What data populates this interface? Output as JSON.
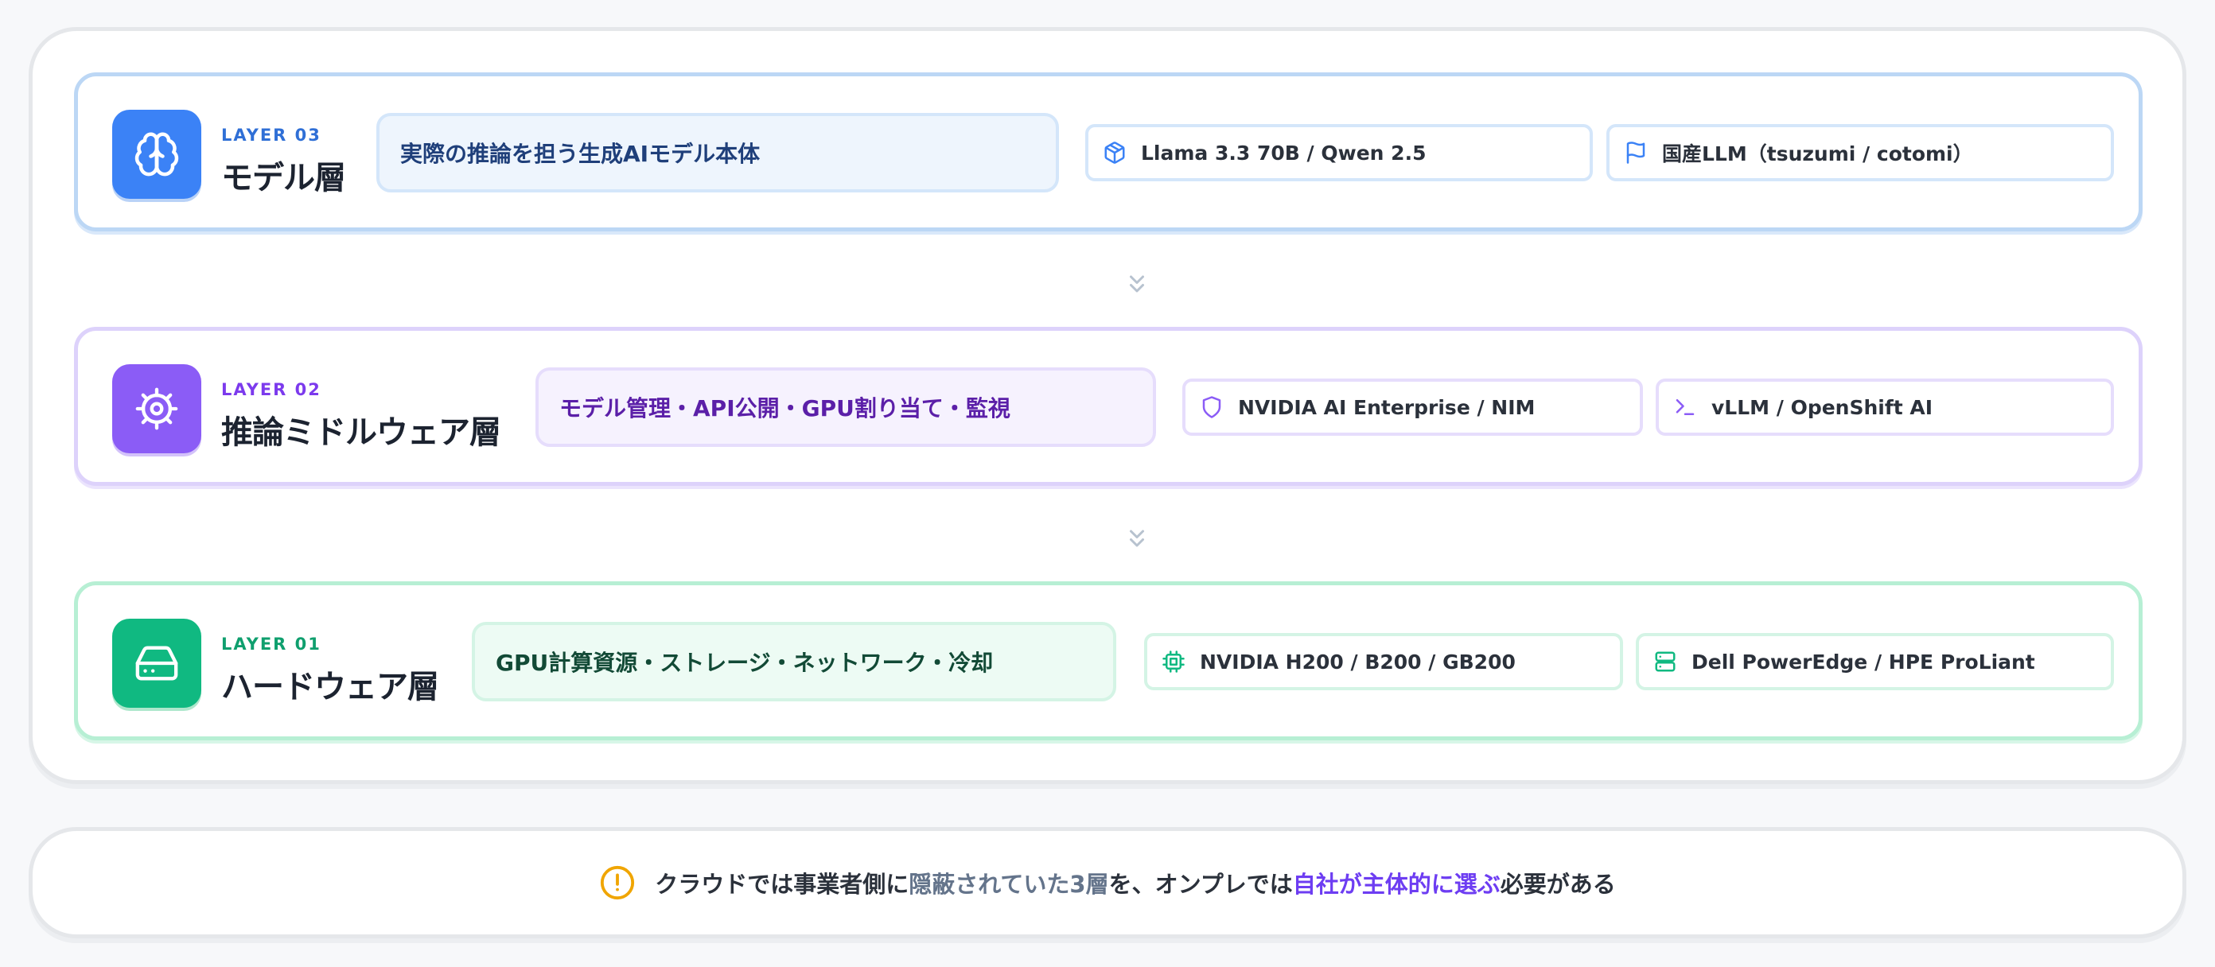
{
  "colors": {
    "layer03_accent": "#3b82f6",
    "layer02_accent": "#8b5cf6",
    "layer01_accent": "#10b981",
    "warning": "#f0a500",
    "highlight_gray": "#64748b",
    "highlight_purple": "#6d3df2"
  },
  "layers": [
    {
      "kicker": "LAYER 03",
      "title": "モデル層",
      "icon": "brain-icon",
      "description": "実際の推論を担う生成AIモデル本体",
      "chips": [
        {
          "icon": "package-icon",
          "label": "Llama 3.3 70B / Qwen 2.5"
        },
        {
          "icon": "flag-icon",
          "label": "国産LLM（tsuzumi / cotomi）"
        }
      ]
    },
    {
      "kicker": "LAYER 02",
      "title": "推論ミドルウェア層",
      "icon": "gear-icon",
      "description": "モデル管理・API公開・GPU割り当て・監視",
      "chips": [
        {
          "icon": "shield-icon",
          "label": "NVIDIA AI Enterprise / NIM"
        },
        {
          "icon": "terminal-icon",
          "label": "vLLM / OpenShift AI"
        }
      ]
    },
    {
      "kicker": "LAYER 01",
      "title": "ハードウェア層",
      "icon": "hard-drive-icon",
      "description": "GPU計算資源・ストレージ・ネットワーク・冷却",
      "chips": [
        {
          "icon": "cpu-icon",
          "label": "NVIDIA H200 / B200 / GB200"
        },
        {
          "icon": "server-icon",
          "label": "Dell PowerEdge / HPE ProLiant"
        }
      ]
    }
  ],
  "note": {
    "icon": "alert-circle-icon",
    "part1": "クラウドでは事業者側に",
    "part2": "隠蔽されていた3層",
    "part3": "を、オンプレでは",
    "part4": "自社が主体的に選ぶ",
    "part5": "必要がある"
  }
}
